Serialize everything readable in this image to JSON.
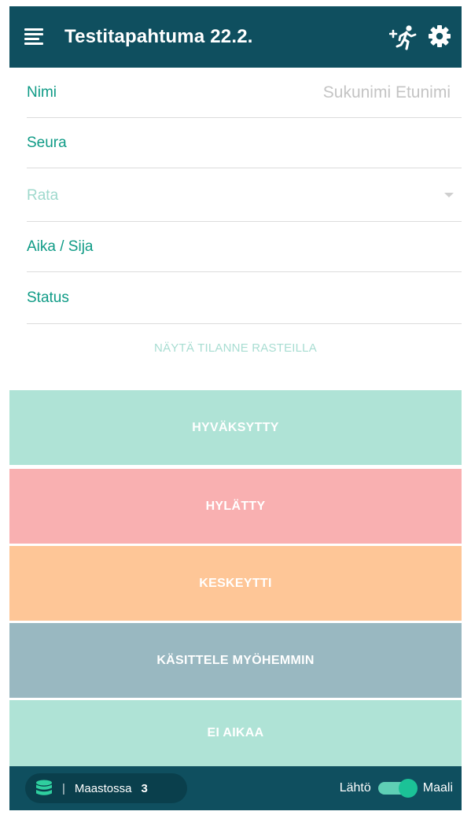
{
  "header": {
    "title": "Testitapahtuma 22.2.",
    "menu_icon": "menu-icon",
    "add_runner_icon": "add-runner-icon",
    "settings_icon": "gear-icon",
    "background": "#0f4f5f"
  },
  "form": {
    "name": {
      "label": "Nimi",
      "placeholder": "Sukunimi Etunimi"
    },
    "club": {
      "label": "Seura"
    },
    "course": {
      "label": "Rata"
    },
    "time_place": {
      "label": "Aika / Sija"
    },
    "status": {
      "label": "Status"
    }
  },
  "show_controls_label": "NÄYTÄ TILANNE RASTEILLA",
  "actions": {
    "approved": "HYVÄKSYTTY",
    "rejected": "HYLÄTTY",
    "dnf": "KESKEYTTI",
    "later": "KÄSITTELE MYÖHEMMIN",
    "no_time": "EI AIKAA"
  },
  "colors": {
    "accent": "#0f9b86",
    "approved": "#afe3d6",
    "rejected": "#f9b0b1",
    "dnf": "#fec697",
    "later": "#99b8c1"
  },
  "footer": {
    "in_terrain_label": "Maastossa",
    "separator": "|",
    "in_terrain_count": "3",
    "start_label": "Lähtö",
    "finish_label": "Maali",
    "toggle_state": "on"
  }
}
